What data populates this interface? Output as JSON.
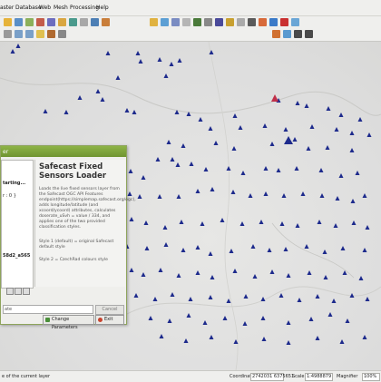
{
  "menubar": {
    "items": [
      "aster",
      "Database",
      "Web",
      "Mesh",
      "Processing",
      "Help"
    ]
  },
  "dialog": {
    "title": "er",
    "left_pane": {
      "lines": [
        "tarting...",
        "r : 0 }",
        "58d2_a565"
      ]
    },
    "help": {
      "title": "Safecast Fixed Sensors Loader",
      "para1": "Loads the live fixed sensors layer from the Safecast OGC API Features endpoint(https://simplemap.safecast.org/ogc), adds longitude/latitude (and xcoord/ycoord) attributes, calculates doserate_uSvh = value / 334, and applies one of the two provided classification styles.",
      "para2": "Style 1 (default) = original Safecast default style",
      "para3": "Style 2 = CzechRad colours style"
    },
    "progress_text": "ate",
    "cancel_label": "Cancel",
    "change_params_label": "Change Parameters",
    "exit_label": "Exit"
  },
  "statusbar": {
    "message": "e of the current layer",
    "coordinate_label": "Coordinate",
    "coordinate_value": "2742031 6375651",
    "scale_label": "Scale",
    "scale_value": "1:4988879",
    "magnifier_label": "Magnifier",
    "magnifier_value": "100%"
  },
  "colors": {
    "marker": "#1d2a8c",
    "accent": "#8db347"
  }
}
